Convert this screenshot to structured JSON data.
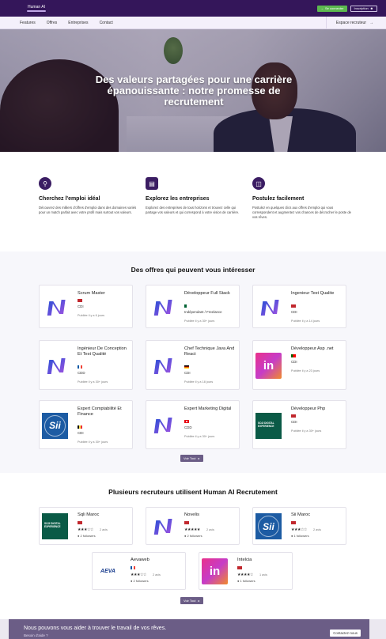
{
  "header": {
    "logo_text": "Human AI",
    "connect_label": "Se connecter",
    "signup_label": "Inscription"
  },
  "nav": {
    "items": [
      "Features",
      "Offres",
      "Entreprises",
      "Contact"
    ],
    "recruiter_label": "Espace recruteur"
  },
  "hero": {
    "title": "Des valeurs partagées pour une carrière épanouissante : notre promesse de recrutement"
  },
  "features": [
    {
      "icon": "search-icon",
      "title": "Cherchez l'emploi idéal",
      "text": "Découvrez des milliers d'offres d'emploi dans des domaines variés pour un match parfait avec votre profil mais surtout vos valeurs."
    },
    {
      "icon": "chart-icon",
      "title": "Explorez les entreprises",
      "text": "Explorez des entreprises de tous horizons et trouvez celle qui partage vos valeurs et qui correspond à votre vision de carrière."
    },
    {
      "icon": "briefcase-icon",
      "title": "Postulez facilement",
      "text": "Postulez en quelques clics aux offres d'emploi qui vous correspondent et augmentez vos chances de décrocher le poste de vos rêves."
    }
  ],
  "offers": {
    "title": "Des offres qui peuvent vous intéresser",
    "see_all": "Voir Tout",
    "items": [
      {
        "title": "Scrum Master",
        "logo": "n-logo",
        "flag": "ma",
        "type": "CDI",
        "date": "Publiée il y a 6 jours"
      },
      {
        "title": "Développeur Full Stack",
        "logo": "n-logo",
        "flag": "dz",
        "type": "Indépendant / Freelance",
        "date": "Publiée il y a 30+ jours"
      },
      {
        "title": "Ingenieur Test Qualite",
        "logo": "n-logo",
        "flag": "ma",
        "type": "CDI",
        "date": "Publiée il y a 14 jours"
      },
      {
        "title": "Ingénieur De Conception Et Test Qualité",
        "logo": "n-logo",
        "flag": "fr",
        "type": "CDD",
        "date": "Publiée il y a 30+ jours"
      },
      {
        "title": "Chef Technique Java And React",
        "logo": "n-logo",
        "flag": "de",
        "type": "CDI",
        "date": "Publiée il y a 18 jours"
      },
      {
        "title": "Développeur Asp .net",
        "logo": "in-logo",
        "flag": "pt",
        "type": "CDI",
        "date": "Publiée il y a 23 jours"
      },
      {
        "title": "Expert Comptabilité Et Finance",
        "logo": "sii-logo",
        "flag": "be",
        "type": "CDI",
        "date": "Publiée il y a 30+ jours"
      },
      {
        "title": "Expert Marketing Digital",
        "logo": "n-logo",
        "flag": "tn",
        "type": "CDD",
        "date": "Publiée il y a 30+ jours"
      },
      {
        "title": "Développeur Php",
        "logo": "soji-logo",
        "flag": "ma",
        "type": "CDI",
        "date": "Publiée il y a 30+ jours"
      }
    ]
  },
  "recruiters": {
    "title": "Plusieurs recruteurs utilisent Human AI Recrutement",
    "see_all": "Voir Tout",
    "items": [
      {
        "name": "Sqli Maroc",
        "logo": "soji-logo",
        "flag": "ma",
        "stars": "★★★☆☆",
        "reviews": "2 avis",
        "followers": "2 followers"
      },
      {
        "name": "Novelis",
        "logo": "n-logo",
        "flag": "ma",
        "stars": "★★★★★",
        "reviews": "2 avis",
        "followers": "2 followers"
      },
      {
        "name": "Sii Maroc",
        "logo": "sii-logo",
        "flag": "ma",
        "stars": "★★★☆☆",
        "reviews": "2 avis",
        "followers": "1 followers"
      },
      {
        "name": "Aevaweb",
        "logo": "aeva-logo",
        "flag": "fr",
        "stars": "★★★☆☆",
        "reviews": "2 avis",
        "followers": "2 followers"
      },
      {
        "name": "Intelcia",
        "logo": "in-logo",
        "flag": "ma",
        "stars": "★★★★☆",
        "reviews": "1 avis",
        "followers": "1 followers"
      }
    ]
  },
  "soji_text": "SOJI DIGITAL EXPERIENCE",
  "sii_text": "Sii",
  "aeva_text": "AEVA",
  "in_text": "in",
  "cta": {
    "title": "Nous pouvons vous aider à trouver le travail de vos rêves.",
    "subtitle": "Besoin d'aide ?",
    "button": "Contactez-nous"
  }
}
